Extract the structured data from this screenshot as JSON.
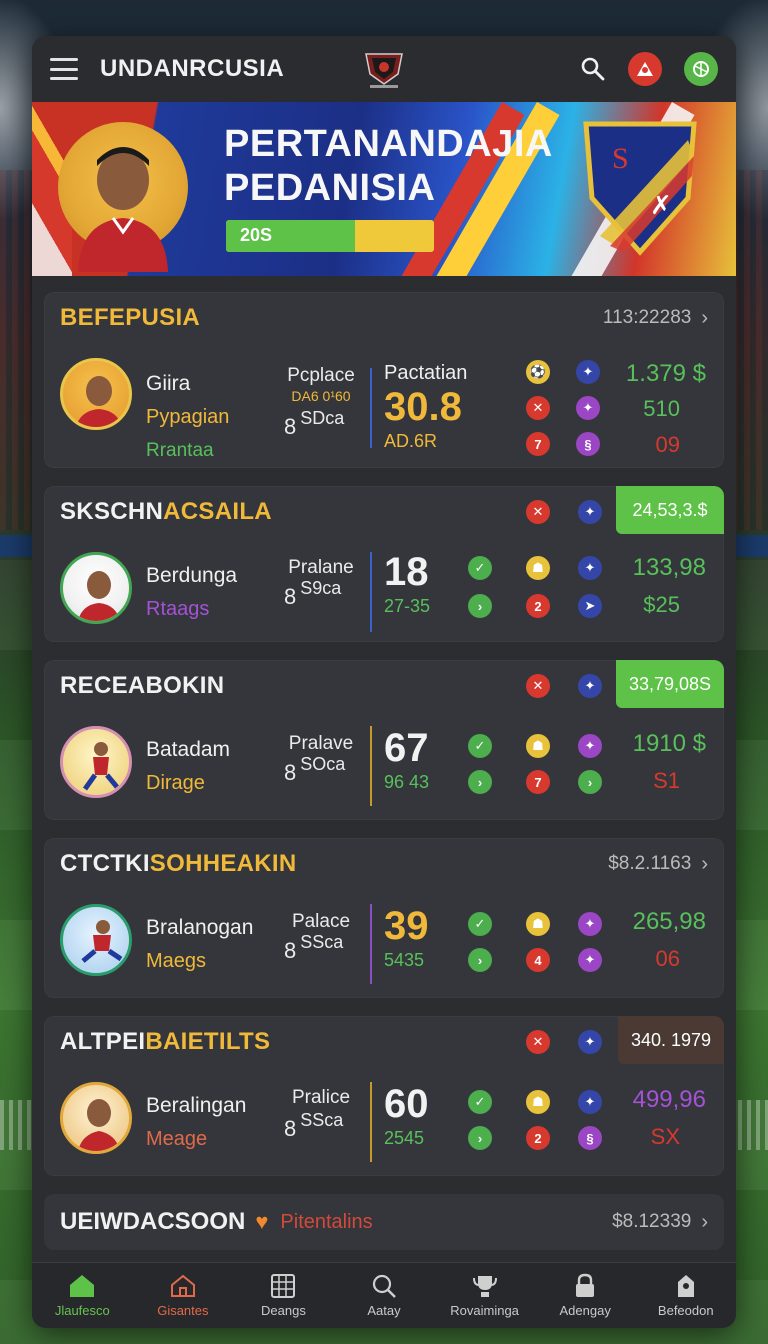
{
  "header": {
    "title": "UNDANRCUSIA",
    "icons": [
      "menu-icon",
      "club-logo",
      "search-icon",
      "red-mascot-icon",
      "green-ball-icon"
    ]
  },
  "banner": {
    "line1": "PERTANANDAJIA",
    "line2": "PEDANISIA",
    "progress_label": "20S",
    "progress_fraction": 0.62
  },
  "cards": [
    {
      "title_a": "",
      "title_b": "BEFEPUSIA",
      "meta": "113:22283",
      "name": "Giira",
      "sub1": "Pypagian",
      "sub2": "Rrantaa",
      "place": "Pcplace",
      "place_small": "DA6 0¹60",
      "sesa_num": "8",
      "sesa_text": "SDca",
      "score_label": "Pactatian",
      "score": "30.8",
      "score_sub": "AD.6R",
      "value": "1.379 $",
      "value2": "510",
      "value3": "09"
    },
    {
      "title_a": "SKSCHN",
      "title_b": "ACSAILA",
      "badge": "24,53,3.$",
      "name": "Berdunga",
      "sub1": "Rtaags",
      "place": "Pralane",
      "sesa_num": "8",
      "sesa_text": "S9ca",
      "score": "18",
      "score_sub": "27-35",
      "value": "133,98",
      "value2": "$25"
    },
    {
      "title_a": "RECEABOKIN",
      "title_b": "",
      "badge": "33,79,08S",
      "name": "Batadam",
      "sub1": "Dirage",
      "place": "Pralave",
      "sesa_num": "8",
      "sesa_text": "SOca",
      "score": "67",
      "score_sub": "96 43",
      "value": "1910 $",
      "value2": "S1"
    },
    {
      "title_a": "CTCTKI",
      "title_b": "SOHHEAKIN",
      "meta": "$8.2.1163",
      "name": "Bralanogan",
      "sub1": "Maegs",
      "place": "Palace",
      "sesa_num": "8",
      "sesa_text": "SSca",
      "score": "39",
      "score_sub": "5435",
      "value": "265,98",
      "value2": "06"
    },
    {
      "title_a": "ALTPEI",
      "title_b": "BAIETILTS",
      "badge": "340. 1979",
      "name": "Beralingan",
      "sub1": "Meage",
      "place": "Pralice",
      "sesa_num": "8",
      "sesa_text": "SSca",
      "score": "60",
      "score_sub": "2545",
      "value": "499,96",
      "value2": "SX"
    }
  ],
  "bottom_card": {
    "title": "UEIWDACSOON",
    "subtitle": "Pitentalins",
    "meta": "$8.12339"
  },
  "nav": [
    {
      "label": "Jlaufesco",
      "icon": "home-icon"
    },
    {
      "label": "Gisantes",
      "icon": "home-outline-icon"
    },
    {
      "label": "Deangs",
      "icon": "calendar-grid-icon"
    },
    {
      "label": "Aatay",
      "icon": "search-icon"
    },
    {
      "label": "Rovaiminga",
      "icon": "trophy-icon"
    },
    {
      "label": "Adengay",
      "icon": "lock-icon"
    },
    {
      "label": "Befeodon",
      "icon": "profile-icon"
    }
  ],
  "colors": {
    "accent_green": "#5ec248",
    "accent_gold": "#f0b93a",
    "accent_red": "#d8392e",
    "card_bg": "#34363b"
  }
}
